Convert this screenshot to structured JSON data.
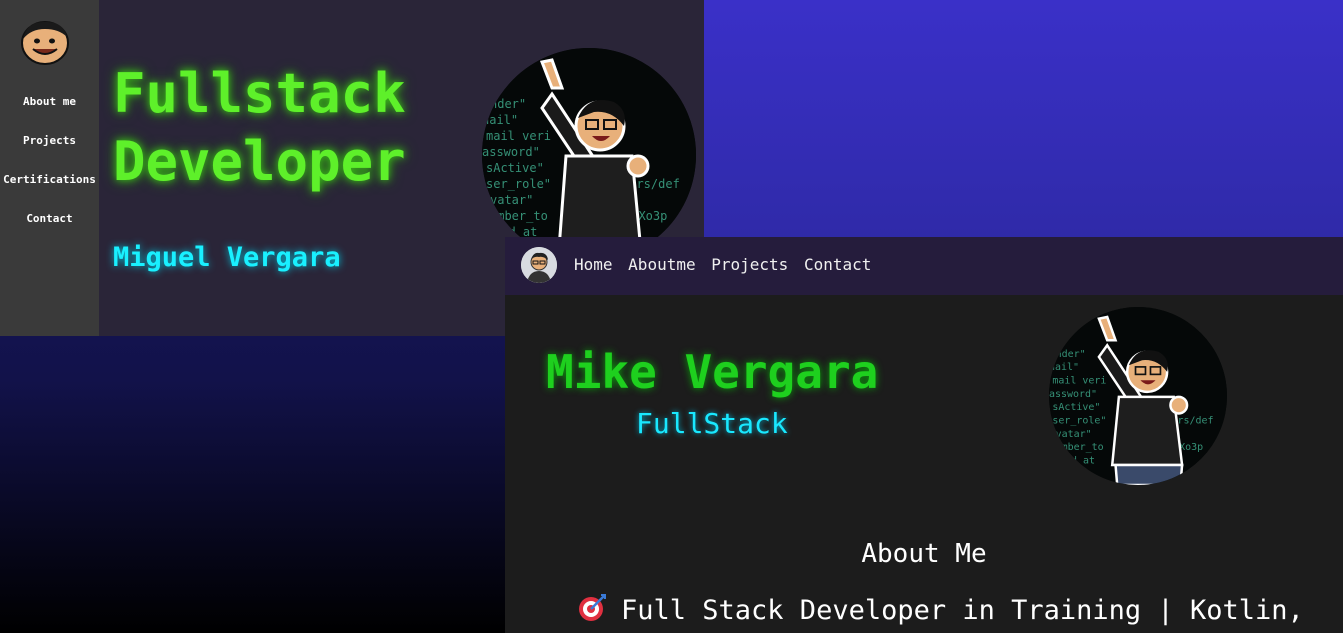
{
  "left_window": {
    "sidebar": {
      "items": [
        {
          "label": "About me"
        },
        {
          "label": "Projects"
        },
        {
          "label": "Certifications"
        },
        {
          "label": "Contact"
        }
      ]
    },
    "hero": {
      "title_line1": "Fullstack",
      "title_line2": "Developer",
      "name": "Miguel Vergara"
    }
  },
  "right_window": {
    "navbar": {
      "links": [
        "Home",
        "Aboutme",
        "Projects",
        "Contact"
      ]
    },
    "hero": {
      "name": "Mike Vergara",
      "role": "FullStack"
    },
    "about": {
      "title": "About Me",
      "line": "Full Stack Developer in Training | Kotlin,"
    }
  },
  "colors": {
    "neon_green": "#5ef02a",
    "neon_cyan": "#19f0ff",
    "nav_bg": "#251c3c",
    "panel_bg": "#2a2538"
  },
  "icons": [
    "avatar-logo",
    "developer-avatar",
    "target-icon"
  ]
}
